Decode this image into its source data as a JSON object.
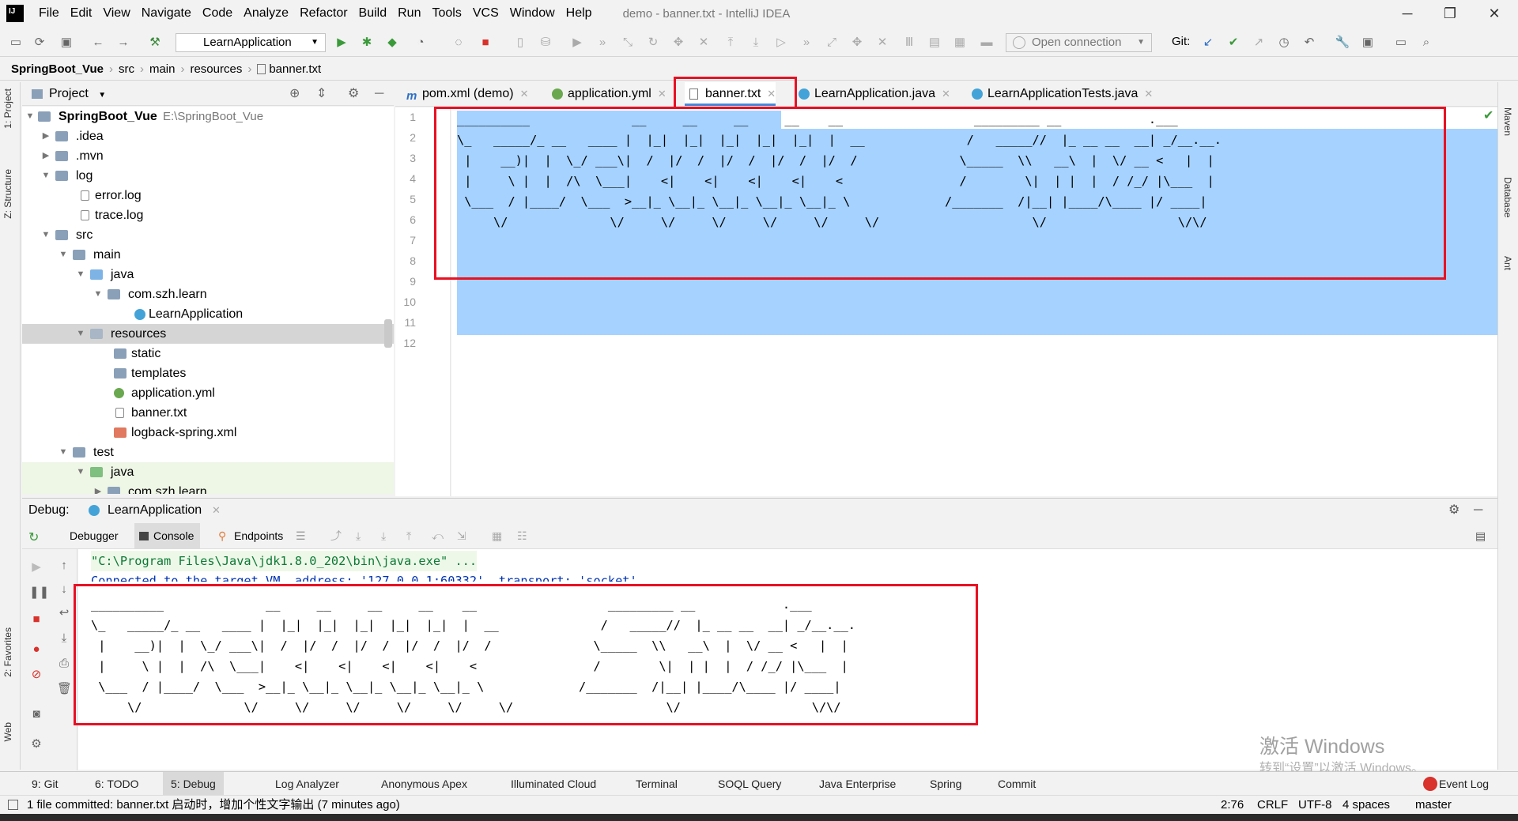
{
  "menu": [
    "File",
    "Edit",
    "View",
    "Navigate",
    "Code",
    "Analyze",
    "Refactor",
    "Build",
    "Run",
    "Tools",
    "VCS",
    "Window",
    "Help"
  ],
  "window_title": "demo - banner.txt - IntelliJ IDEA",
  "window_controls": {
    "minimize": "─",
    "maximize": "❐",
    "close": "✕"
  },
  "toolbar": {
    "run_config": "LearnApplication",
    "open_connection": "Open connection",
    "git_label": "Git:"
  },
  "breadcrumb": [
    "SpringBoot_Vue",
    "src",
    "main",
    "resources",
    "banner.txt"
  ],
  "left_strip": {
    "project": "1: Project",
    "structure": "Z: Structure",
    "favorites": "2: Favorites",
    "web": "Web"
  },
  "right_strip": {
    "maven": "Maven",
    "database": "Database",
    "ant": "Ant"
  },
  "project_panel": {
    "title": "Project"
  },
  "tree": [
    {
      "label": "SpringBoot_Vue",
      "extra": "E:\\SpringBoot_Vue",
      "bold": true
    },
    {
      "label": ".idea"
    },
    {
      "label": ".mvn"
    },
    {
      "label": "log"
    },
    {
      "label": "error.log"
    },
    {
      "label": "trace.log"
    },
    {
      "label": "src"
    },
    {
      "label": "main"
    },
    {
      "label": "java"
    },
    {
      "label": "com.szh.learn"
    },
    {
      "label": "LearnApplication"
    },
    {
      "label": "resources"
    },
    {
      "label": "static"
    },
    {
      "label": "templates"
    },
    {
      "label": "application.yml"
    },
    {
      "label": "banner.txt"
    },
    {
      "label": "logback-spring.xml"
    },
    {
      "label": "test"
    },
    {
      "label": "java"
    },
    {
      "label": "com.szh.learn"
    }
  ],
  "editor_tabs": [
    "pom.xml (demo)",
    "application.yml",
    "banner.txt",
    "LearnApplication.java",
    "LearnApplicationTests.java"
  ],
  "line_numbers": [
    "1",
    "2",
    "3",
    "4",
    "5",
    "6",
    "7",
    "8",
    "9",
    "10",
    "11",
    "12"
  ],
  "banner_lines": [
    "__________              __     __     __     __    __                  _________ __            .___",
    "\\_   _____/_ __   ____ |  |_|  |_|  |_|  |_|  |_|  |  __              /   _____//  |_ __ __  __| _/__.__.",
    " |    __)|  |  \\_/ ___\\|  /  |/  /  |/  /  |/  /  |/  /              \\_____  \\\\   __\\  |  \\/ __ <   |  |",
    " |     \\ |  |  /\\  \\___|    <|    <|    <|    <|    <                /        \\|  | |  |  / /_/ |\\___  |",
    " \\___  / |____/  \\___  >__|_ \\__|_ \\__|_ \\__|_ \\__|_ \\             /_______  /|__| |____/\\____ |/ ____|",
    "     \\/              \\/     \\/     \\/     \\/     \\/     \\/                     \\/                  \\/\\/"
  ],
  "debug": {
    "label": "Debug:",
    "config": "LearnApplication",
    "tabs": [
      "Debugger",
      "Console",
      "Endpoints"
    ]
  },
  "console_lines": [
    "\"C:\\Program Files\\Java\\jdk1.8.0_202\\bin\\java.exe\" ...",
    "Connected to the target VM, address: '127.0.0.1:60332', transport: 'socket'"
  ],
  "bottom_tabs": [
    "9: Git",
    "6: TODO",
    "5: Debug",
    "Log Analyzer",
    "Anonymous Apex",
    "Illuminated Cloud",
    "Terminal",
    "SOQL Query",
    "Java Enterprise",
    "Spring",
    "Commit",
    "Event Log"
  ],
  "status": {
    "message": "1 file committed: banner.txt 启动时，增加个性文字输出 (7 minutes ago)",
    "position": "2:76",
    "line_sep": "CRLF",
    "encoding": "UTF-8",
    "indent": "4 spaces",
    "branch": "master"
  },
  "watermark": {
    "line1": "激活 Windows",
    "line2": "转到“设置”以激活 Windows。"
  },
  "colors": {
    "selection": "#a6d2ff",
    "highlight_box": "#e81123",
    "console_blue": "#0033b3"
  }
}
